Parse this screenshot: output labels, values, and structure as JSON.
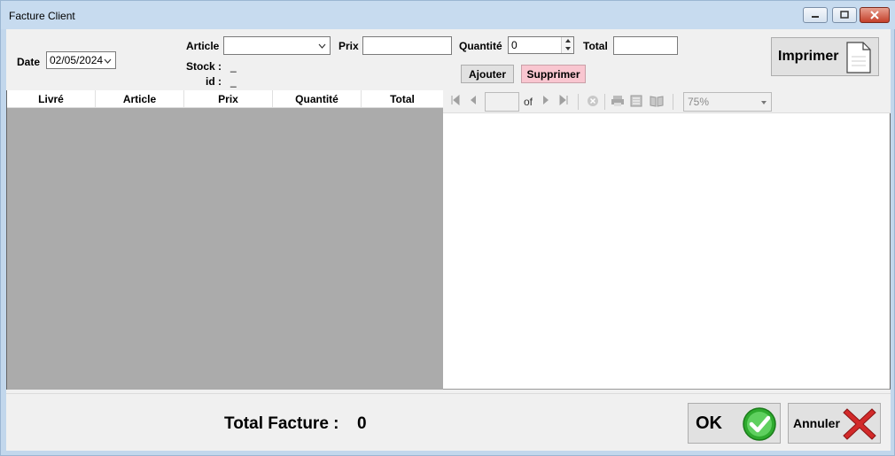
{
  "window": {
    "title": "Facture Client"
  },
  "header": {
    "date_label": "Date",
    "date_value": "02/05/2024",
    "article_label": "Article",
    "article_value": "",
    "prix_label": "Prix",
    "prix_value": "",
    "quantite_label": "Quantité",
    "quantite_value": "0",
    "total_label": "Total",
    "total_value": "",
    "stock_label": "Stock :",
    "stock_value": "_",
    "id_label": "id :",
    "id_value": "_",
    "ajouter_label": "Ajouter",
    "supprimer_label": "Supprimer",
    "imprimer_label": "Imprimer"
  },
  "grid": {
    "columns": [
      "Livré",
      "Article",
      "Prix",
      "Quantité",
      "Total"
    ]
  },
  "viewer": {
    "page_value": "",
    "of_label": "of",
    "zoom_value": "75%"
  },
  "footer": {
    "total_facture_label": "Total Facture :",
    "total_facture_value": "0",
    "ok_label": "OK",
    "annuler_label": "Annuler"
  },
  "colors": {
    "supprimer_bg": "#f9c6d0",
    "ok_check": "#2eaa2e",
    "annuler_x": "#d22a2a",
    "grid_bg": "#ababab"
  }
}
